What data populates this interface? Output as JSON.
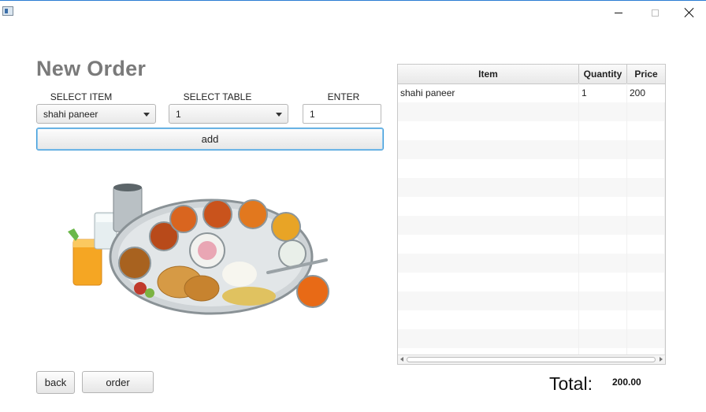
{
  "window": {
    "title": ""
  },
  "page": {
    "title": "New Order"
  },
  "form": {
    "item_label": "SELECT ITEM",
    "table_label": "SELECT TABLE",
    "quantity_label": "ENTER QUANTITY",
    "item_value": "shahi paneer",
    "table_value": "1",
    "quantity_value": "1",
    "add_label": "add"
  },
  "image": {
    "icon": "thali-food-platter-image"
  },
  "order_table": {
    "columns": [
      "Item",
      "Quantity",
      "Price"
    ],
    "rows": [
      {
        "item": "shahi paneer",
        "quantity": "1",
        "price": "200"
      }
    ]
  },
  "footer": {
    "back_label": "back",
    "order_label": "order",
    "total_label": "Total:",
    "total_value": "200.00"
  },
  "colors": {
    "accent": "#3c9ad8",
    "title": "#7a7a7a",
    "titlebar_border": "#2b7cd3"
  }
}
